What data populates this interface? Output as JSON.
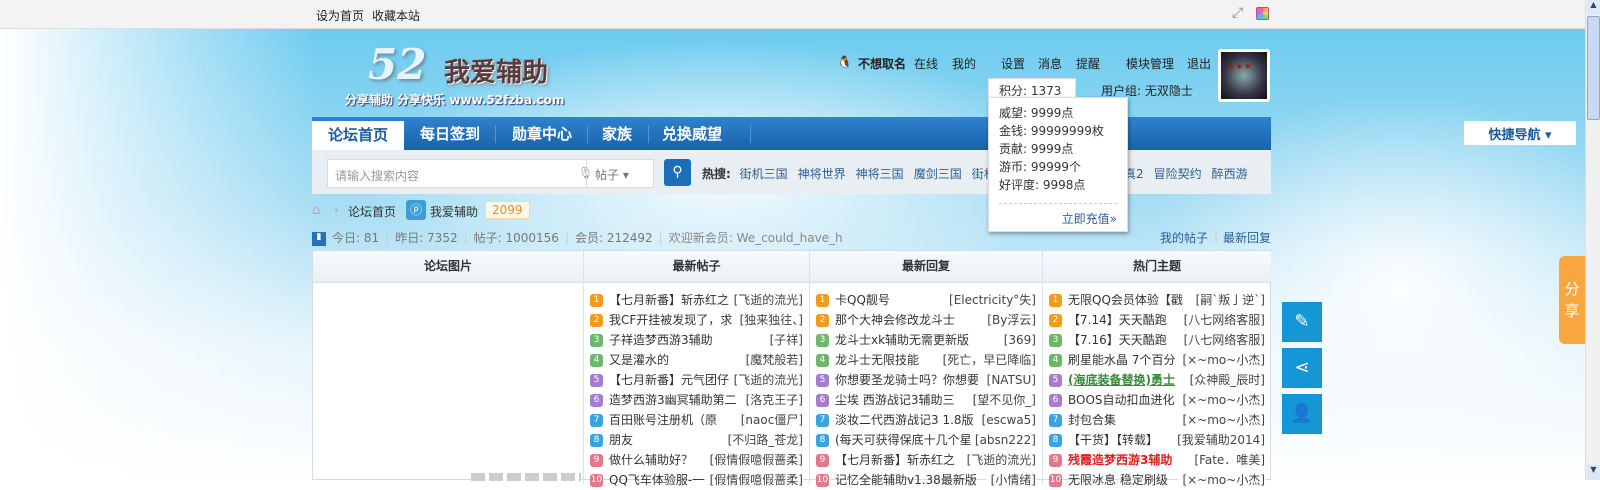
{
  "topbar": {
    "set_home": "设为首页",
    "bookmark": "收藏本站"
  },
  "logo": {
    "number": "52",
    "name": "我爱辅助",
    "slogan": "分享辅助  分享快乐  www.52fzba.com"
  },
  "user": {
    "name": "不想取名",
    "status": "在线",
    "links": [
      "我的",
      "设置",
      "消息",
      "提醒",
      "模块管理",
      "退出"
    ],
    "points_label": "积分: 1373",
    "group": "用户组: 无双隐士"
  },
  "points_dropdown": {
    "items": [
      "威望: 9999点",
      "金钱: 99999999枚",
      "贡献: 9999点",
      "游币: 99999个",
      "好评度: 9998点"
    ],
    "recharge": "立即充值»"
  },
  "nav": {
    "items": [
      "论坛首页",
      "每日签到",
      "勋章中心",
      "家族",
      "兑换威望"
    ],
    "quick": "快捷导航 ▾"
  },
  "search": {
    "placeholder": "请输入搜索内容",
    "type": "帖子",
    "hot_label": "热搜:",
    "hot": [
      "街机三国",
      "神将世界",
      "神将三国",
      "魔剑三国",
      "街机",
      "修真2",
      "冒险契约",
      "醉西游"
    ]
  },
  "breadcrumb": {
    "home": "论坛首页",
    "forum": "我爱辅助",
    "count": "2099"
  },
  "stats": {
    "today": "今日: 81",
    "yesterday": "昨日: 7352",
    "posts": "帖子: 1000156",
    "members": "会员: 212492",
    "newest": "欢迎新会员: We_could_have_h",
    "my_posts": "我的帖子",
    "latest_replies": "最新回复"
  },
  "colors": [
    "#f39a1e",
    "#f39a1e",
    "#6bb86b",
    "#6bb86b",
    "#a77bd0",
    "#a77bd0",
    "#3ba3e0",
    "#3ba3e0",
    "#e07a8a",
    "#e07a8a"
  ],
  "board": {
    "headers": [
      "论坛图片",
      "最新帖子",
      "最新回复",
      "热门主题"
    ],
    "latest_posts": [
      [
        "【七月新番】斩赤红之",
        "[飞逝的流光]"
      ],
      [
        "我CF开挂被发现了，求",
        "[独来独往、]"
      ],
      [
        "子祥造梦西游3辅助",
        "[子祥]"
      ],
      [
        "又是灌水的",
        "[魔梵般若]"
      ],
      [
        "【七月新番】元气团仔",
        "[飞逝的流光]"
      ],
      [
        "造梦西游3幽冥辅助第二",
        "[洛克王子]"
      ],
      [
        "百田账号注册机（原",
        "[naoc僵尸]"
      ],
      [
        "朋友",
        "[不归路_苍龙]"
      ],
      [
        "做什么辅助好？",
        "[假情假噫假蔷柔]"
      ],
      [
        "QQ飞车体验服-一",
        "[假情假噫假蔷柔]"
      ]
    ],
    "latest_replies": [
      [
        "卡QQ靓号",
        "[Electricity°失]"
      ],
      [
        "那个大神会修改龙斗士",
        "[By浮云]"
      ],
      [
        "龙斗士xk辅助无需更新版",
        "[369]"
      ],
      [
        "龙斗士无限技能",
        "[死亡，早已降临]"
      ],
      [
        "你想要圣龙骑士吗？你想要",
        "[NATSU]"
      ],
      [
        "尘埃 西游战记3辅助三",
        "[望不见你_]"
      ],
      [
        "淡妆二代西游战记3 1.8版",
        "[escwa5]"
      ],
      [
        "(每天可获得保底十几个星",
        "[absn222]"
      ],
      [
        "【七月新番】斩赤红之",
        "[飞逝的流光]"
      ],
      [
        "记忆全能辅助v1.38最新版",
        "[小情绪]"
      ]
    ],
    "hot_topics": [
      [
        "无限QQ会员体验【戳",
        "[嗣`叛亅逆`]"
      ],
      [
        "【7.14】天天酷跑",
        "[八七网络客服]"
      ],
      [
        "【7.16】天天酷跑",
        "[八七网络客服]"
      ],
      [
        "刷星能水晶 7个百分",
        "[×~mo~小杰]"
      ],
      [
        "(海底装备替换)勇士",
        "[众神殿_辰时]"
      ],
      [
        "BOOS自动扣血进化",
        "[×~mo~小杰]"
      ],
      [
        "封包合集",
        "[×~mo~小杰]"
      ],
      [
        "【干货】【转载】",
        "[我爱辅助2014]"
      ],
      [
        "残霞造梦西游3辅助",
        "[Fate．唯美]"
      ],
      [
        "无限冰息 稳定刷级",
        "[×~mo~小杰]"
      ]
    ]
  },
  "share_tab": "分享"
}
